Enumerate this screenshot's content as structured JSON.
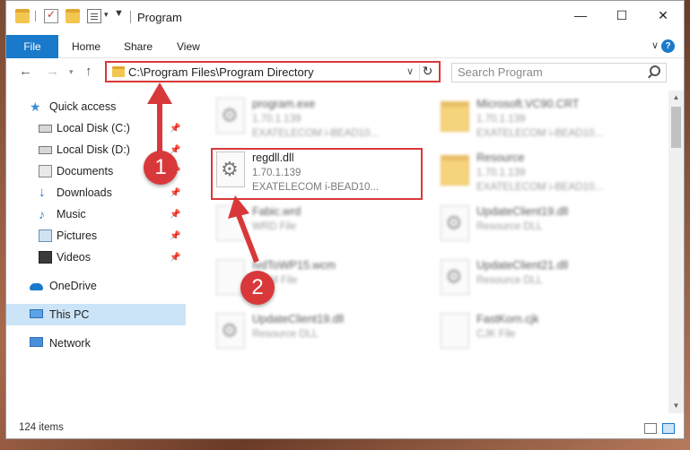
{
  "window": {
    "title": "Program",
    "controls": {
      "minimize": "—",
      "maximize": "☐",
      "close": "✕"
    }
  },
  "ribbon": {
    "tabs": [
      {
        "label": "File",
        "active": true
      },
      {
        "label": "Home"
      },
      {
        "label": "Share"
      },
      {
        "label": "View"
      }
    ],
    "accent_color": "#1979ca"
  },
  "navigation": {
    "address": "C:\\Program Files\\Program Directory",
    "search_placeholder": "Search Program"
  },
  "sidebar": {
    "items": [
      {
        "label": "Quick access",
        "icon": "star-icon",
        "pinned": false
      },
      {
        "label": "Local Disk (C:)",
        "icon": "disk-icon",
        "pinned": true
      },
      {
        "label": "Local Disk (D:)",
        "icon": "disk-icon",
        "pinned": true
      },
      {
        "label": "Documents",
        "icon": "documents-icon",
        "pinned": true
      },
      {
        "label": "Downloads",
        "icon": "download-icon",
        "pinned": true
      },
      {
        "label": "Music",
        "icon": "music-icon",
        "pinned": true
      },
      {
        "label": "Pictures",
        "icon": "pictures-icon",
        "pinned": true
      },
      {
        "label": "Videos",
        "icon": "videos-icon",
        "pinned": true
      },
      {
        "label": "OneDrive",
        "icon": "onedrive-icon",
        "pinned": false
      },
      {
        "label": "This PC",
        "icon": "pc-icon",
        "selected": true
      },
      {
        "label": "Network",
        "icon": "network-icon",
        "pinned": false
      }
    ]
  },
  "files": [
    {
      "name": "program.exe",
      "line1": "1.70.1.139",
      "line2": "EXATELECOM i-BEAD10...",
      "icon": "exe-icon",
      "blurred": true
    },
    {
      "name": "Microsoft.VC90.CRT",
      "line1": "1.70.1.139",
      "line2": "EXATELECOM i-BEAD10...",
      "icon": "folder-icon",
      "blurred": true
    },
    {
      "name": "regdll.dll",
      "line1": "1.70.1.139",
      "line2": "EXATELECOM i-BEAD10...",
      "icon": "dll-icon",
      "blurred": false,
      "highlighted": true
    },
    {
      "name": "Resource",
      "line1": "1.70.1.139",
      "line2": "EXATELECOM i-BEAD10...",
      "icon": "folder-icon",
      "blurred": true
    },
    {
      "name": "Fabic.wrd",
      "line1": "WRD File",
      "line2": "",
      "icon": "file-icon",
      "blurred": true
    },
    {
      "name": "UpdateClient19.dll",
      "line1": "Resource DLL",
      "line2": "",
      "icon": "dll-icon",
      "blurred": true
    },
    {
      "name": "IvdToWP15.wcm",
      "line1": "WCM File",
      "line2": "",
      "icon": "file-icon",
      "blurred": true
    },
    {
      "name": "UpdateClient21.dll",
      "line1": "Resource DLL",
      "line2": "",
      "icon": "dll-icon",
      "blurred": true
    },
    {
      "name": "UpdateClient19.dll",
      "line1": "Resource DLL",
      "line2": "",
      "icon": "dll-icon",
      "blurred": true
    },
    {
      "name": "FastKorn.cjk",
      "line1": "CJK File",
      "line2": "",
      "icon": "file-icon",
      "blurred": true
    }
  ],
  "status": {
    "item_count": "124 items"
  },
  "callouts": [
    {
      "number": "1",
      "color": "#d9383a"
    },
    {
      "number": "2",
      "color": "#d9383a"
    }
  ]
}
